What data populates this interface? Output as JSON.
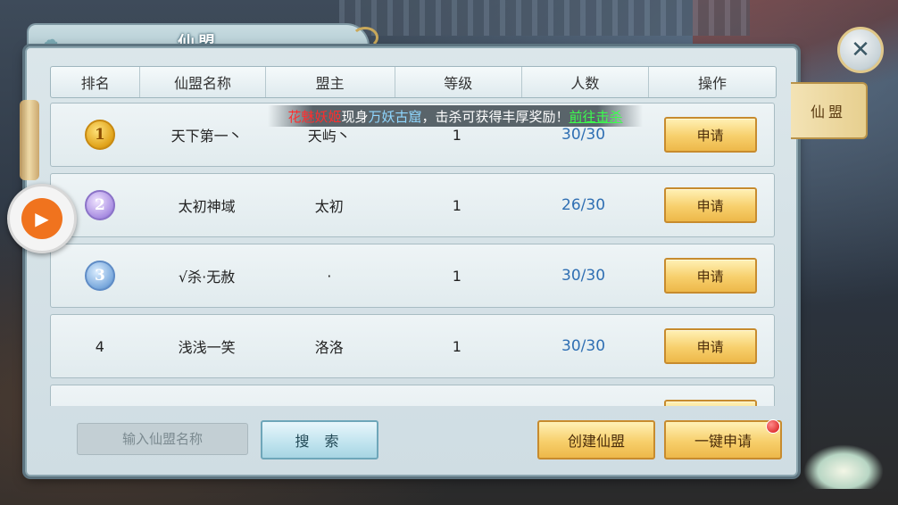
{
  "panel": {
    "title": "仙盟"
  },
  "table": {
    "headers": [
      "排名",
      "仙盟名称",
      "盟主",
      "等级",
      "人数",
      "操作"
    ],
    "rows": [
      {
        "rank": "1",
        "name": "天下第一丶",
        "leader": "天屿丶",
        "level": "1",
        "members": "30/30",
        "action": "申请"
      },
      {
        "rank": "2",
        "name": "太初神域",
        "leader": "太初",
        "level": "1",
        "members": "26/30",
        "action": "申请"
      },
      {
        "rank": "3",
        "name": "√杀·无赦",
        "leader": "·",
        "level": "1",
        "members": "30/30",
        "action": "申请"
      },
      {
        "rank": "4",
        "name": "浅浅一笑",
        "leader": "洛洛",
        "level": "1",
        "members": "30/30",
        "action": "申请"
      }
    ]
  },
  "marquee": {
    "boss": "花魅妖姬",
    "text1": "现身",
    "place": "万妖古窟",
    "text2": "，击杀可获得丰厚奖励！",
    "link": "前往击杀"
  },
  "bottom": {
    "search_placeholder": "输入仙盟名称",
    "search_label": "搜 索",
    "create_label": "创建仙盟",
    "onekey_label": "一键申请"
  },
  "side_tab": {
    "label": "仙盟"
  },
  "icons": {
    "close": "close-icon",
    "float": "play-icon",
    "medals": [
      "gold-medal-icon",
      "silver-medal-icon",
      "bronze-medal-icon"
    ]
  },
  "colors": {
    "member_count": "#2f6fb3",
    "marquee_boss": "#ff2d2d",
    "marquee_place": "#8fd7ff",
    "marquee_link": "#3cff4d",
    "gold_button": "#f7cf6b",
    "blue_button": "#bfe3ee"
  }
}
